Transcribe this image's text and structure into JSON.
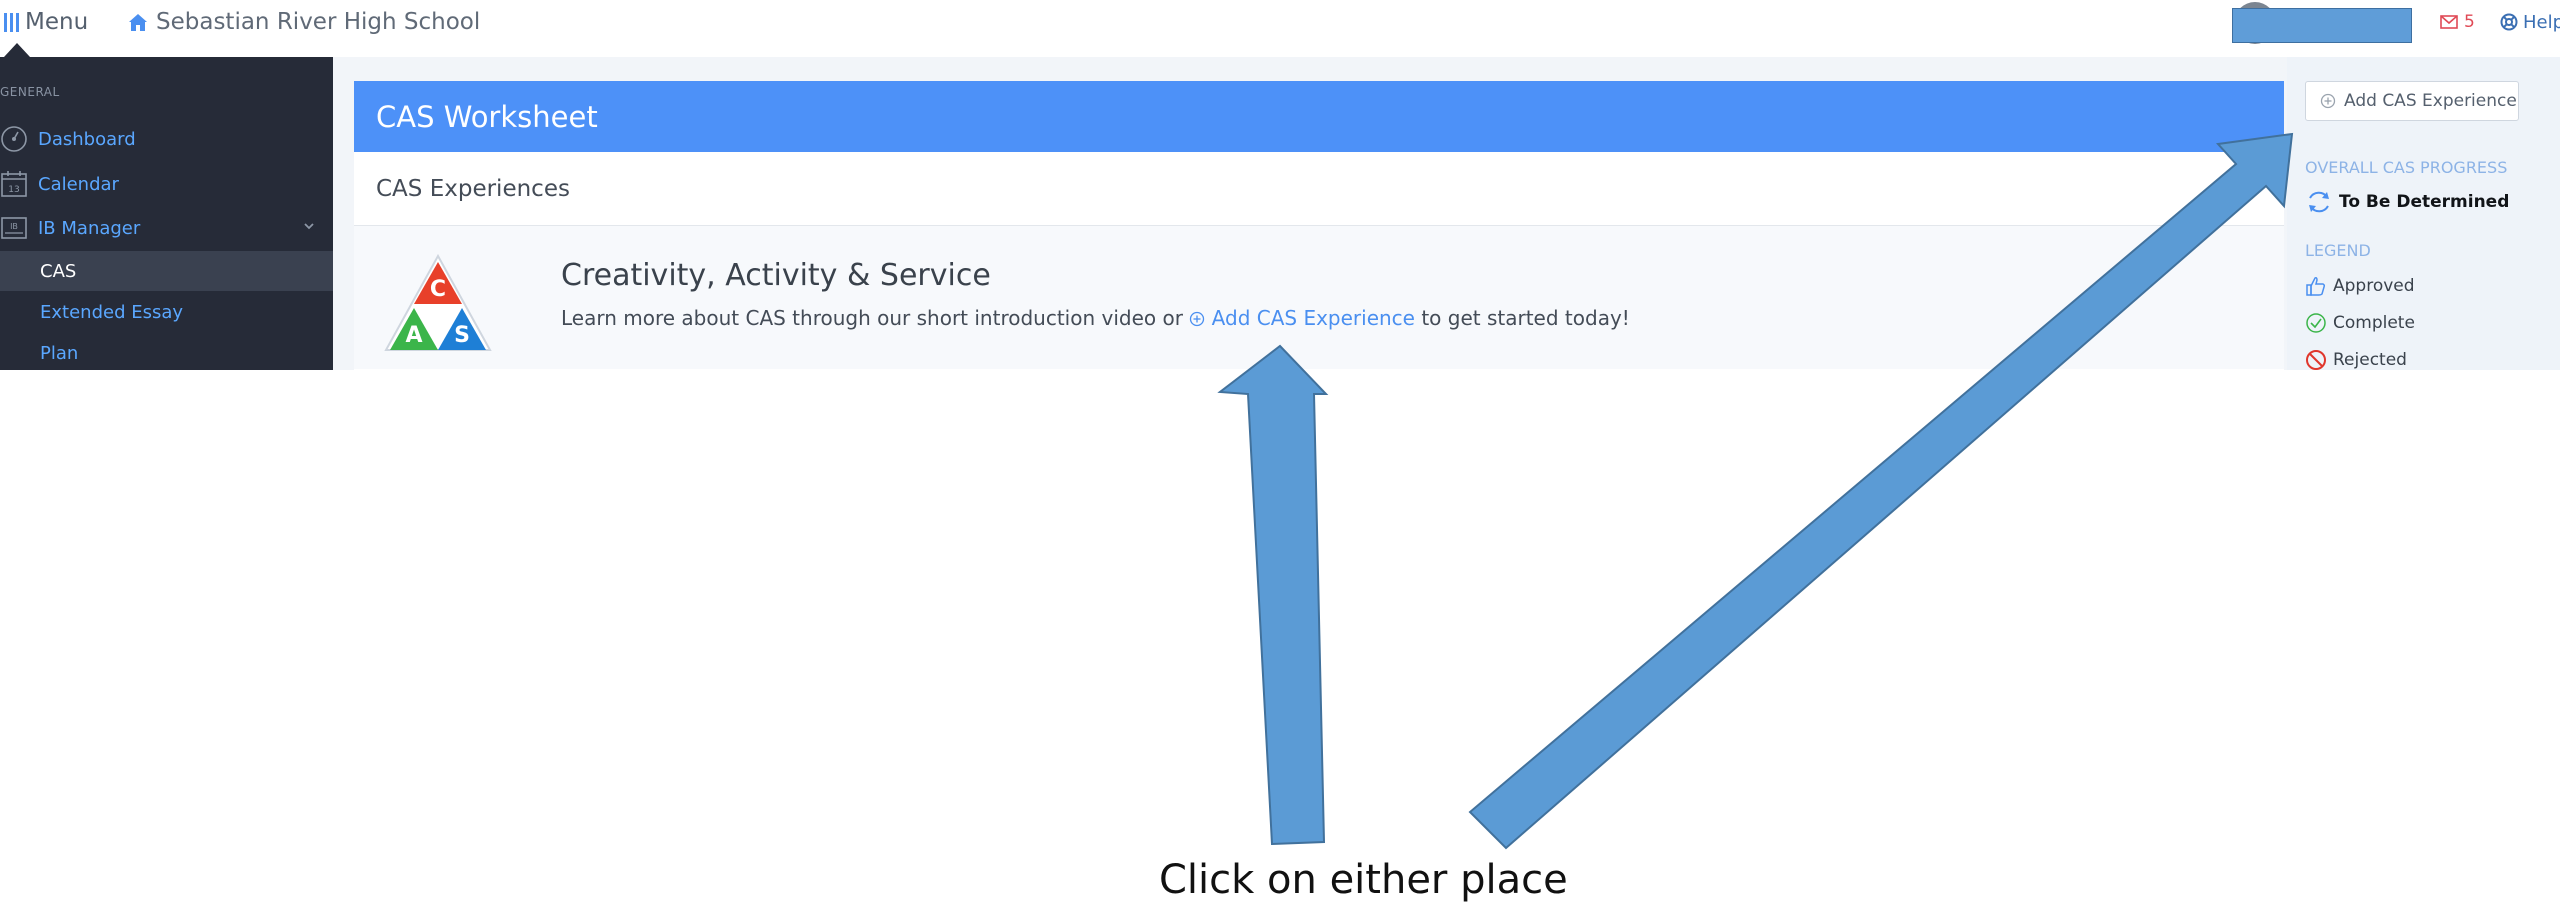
{
  "topbar": {
    "menu_label": "Menu",
    "school_name": "Sebastian River High School",
    "messages_count": "5",
    "help_label": "Help"
  },
  "sidebar": {
    "section_label": "GENERAL",
    "items": [
      {
        "label": "Dashboard",
        "icon": "dashboard-gauge-icon"
      },
      {
        "label": "Calendar",
        "icon": "calendar-icon",
        "icon_text": "13"
      },
      {
        "label": "IB Manager",
        "icon": "ib-icon",
        "icon_text": "IB"
      }
    ],
    "subitems": [
      {
        "label": "CAS",
        "active": true
      },
      {
        "label": "Extended Essay",
        "active": false
      },
      {
        "label": "Plan",
        "active": false
      }
    ]
  },
  "main": {
    "header_title": "CAS Worksheet",
    "subheader": "CAS Experiences",
    "intro_title": "Creativity, Activity & Service",
    "intro_text_before": "Learn more about CAS through our short introduction video or",
    "intro_link": "Add CAS Experience",
    "intro_text_after": "to get started today!",
    "logo_letters": [
      "C",
      "A",
      "S"
    ]
  },
  "right_panel": {
    "add_button": "Add CAS Experience",
    "progress_label": "OVERALL CAS PROGRESS",
    "progress_value": "To Be Determined",
    "legend_label": "LEGEND",
    "legend": [
      {
        "label": "Approved",
        "icon": "thumbs-up-icon"
      },
      {
        "label": "Complete",
        "icon": "check-circle-icon"
      },
      {
        "label": "Rejected",
        "icon": "ban-icon"
      }
    ]
  },
  "annotation": {
    "caption": "Click on either place"
  },
  "colors": {
    "accent": "#4d91f8",
    "sidebar_bg": "#262b38",
    "link": "#4a8ff0",
    "arrow_fill": "#5b9bd5",
    "message_red": "#e04a56"
  }
}
